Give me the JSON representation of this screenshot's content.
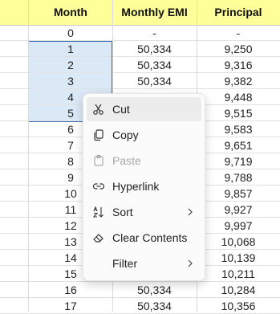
{
  "headers": [
    "Month",
    "Monthly EMI",
    "Principal"
  ],
  "rows": [
    {
      "month": "0",
      "emi": "-",
      "principal": "-"
    },
    {
      "month": "1",
      "emi": "50,334",
      "principal": "9,250"
    },
    {
      "month": "2",
      "emi": "50,334",
      "principal": "9,316"
    },
    {
      "month": "3",
      "emi": "50,334",
      "principal": "9,382"
    },
    {
      "month": "4",
      "emi": "",
      "principal": "9,448"
    },
    {
      "month": "5",
      "emi": "",
      "principal": "9,515"
    },
    {
      "month": "6",
      "emi": "",
      "principal": "9,583"
    },
    {
      "month": "7",
      "emi": "",
      "principal": "9,651"
    },
    {
      "month": "8",
      "emi": "",
      "principal": "9,719"
    },
    {
      "month": "9",
      "emi": "",
      "principal": "9,788"
    },
    {
      "month": "10",
      "emi": "",
      "principal": "9,857"
    },
    {
      "month": "11",
      "emi": "",
      "principal": "9,927"
    },
    {
      "month": "12",
      "emi": "",
      "principal": "9,997"
    },
    {
      "month": "13",
      "emi": "",
      "principal": "10,068"
    },
    {
      "month": "14",
      "emi": "",
      "principal": "10,139"
    },
    {
      "month": "15",
      "emi": "",
      "principal": "10,211"
    },
    {
      "month": "16",
      "emi": "50,334",
      "principal": "10,284"
    },
    {
      "month": "17",
      "emi": "50,334",
      "principal": "10,356"
    }
  ],
  "context_menu": {
    "items": [
      {
        "label": "Cut",
        "icon": "scissors-icon",
        "state": "hover",
        "submenu": false
      },
      {
        "label": "Copy",
        "icon": "copy-icon",
        "state": "normal",
        "submenu": false
      },
      {
        "label": "Paste",
        "icon": "clipboard-icon",
        "state": "disabled",
        "submenu": false
      },
      {
        "label": "Hyperlink",
        "icon": "link-icon",
        "state": "normal",
        "submenu": false
      },
      {
        "label": "Sort",
        "icon": "sort-icon",
        "state": "normal",
        "submenu": true
      },
      {
        "label": "Clear Contents",
        "icon": "eraser-icon",
        "state": "normal",
        "submenu": false
      },
      {
        "label": "Filter",
        "icon": "",
        "state": "normal",
        "submenu": true
      }
    ]
  },
  "colors": {
    "header_bg": "#ffff99",
    "selection_fill": "#dbe8f6",
    "selection_border": "#3b6fb6"
  }
}
